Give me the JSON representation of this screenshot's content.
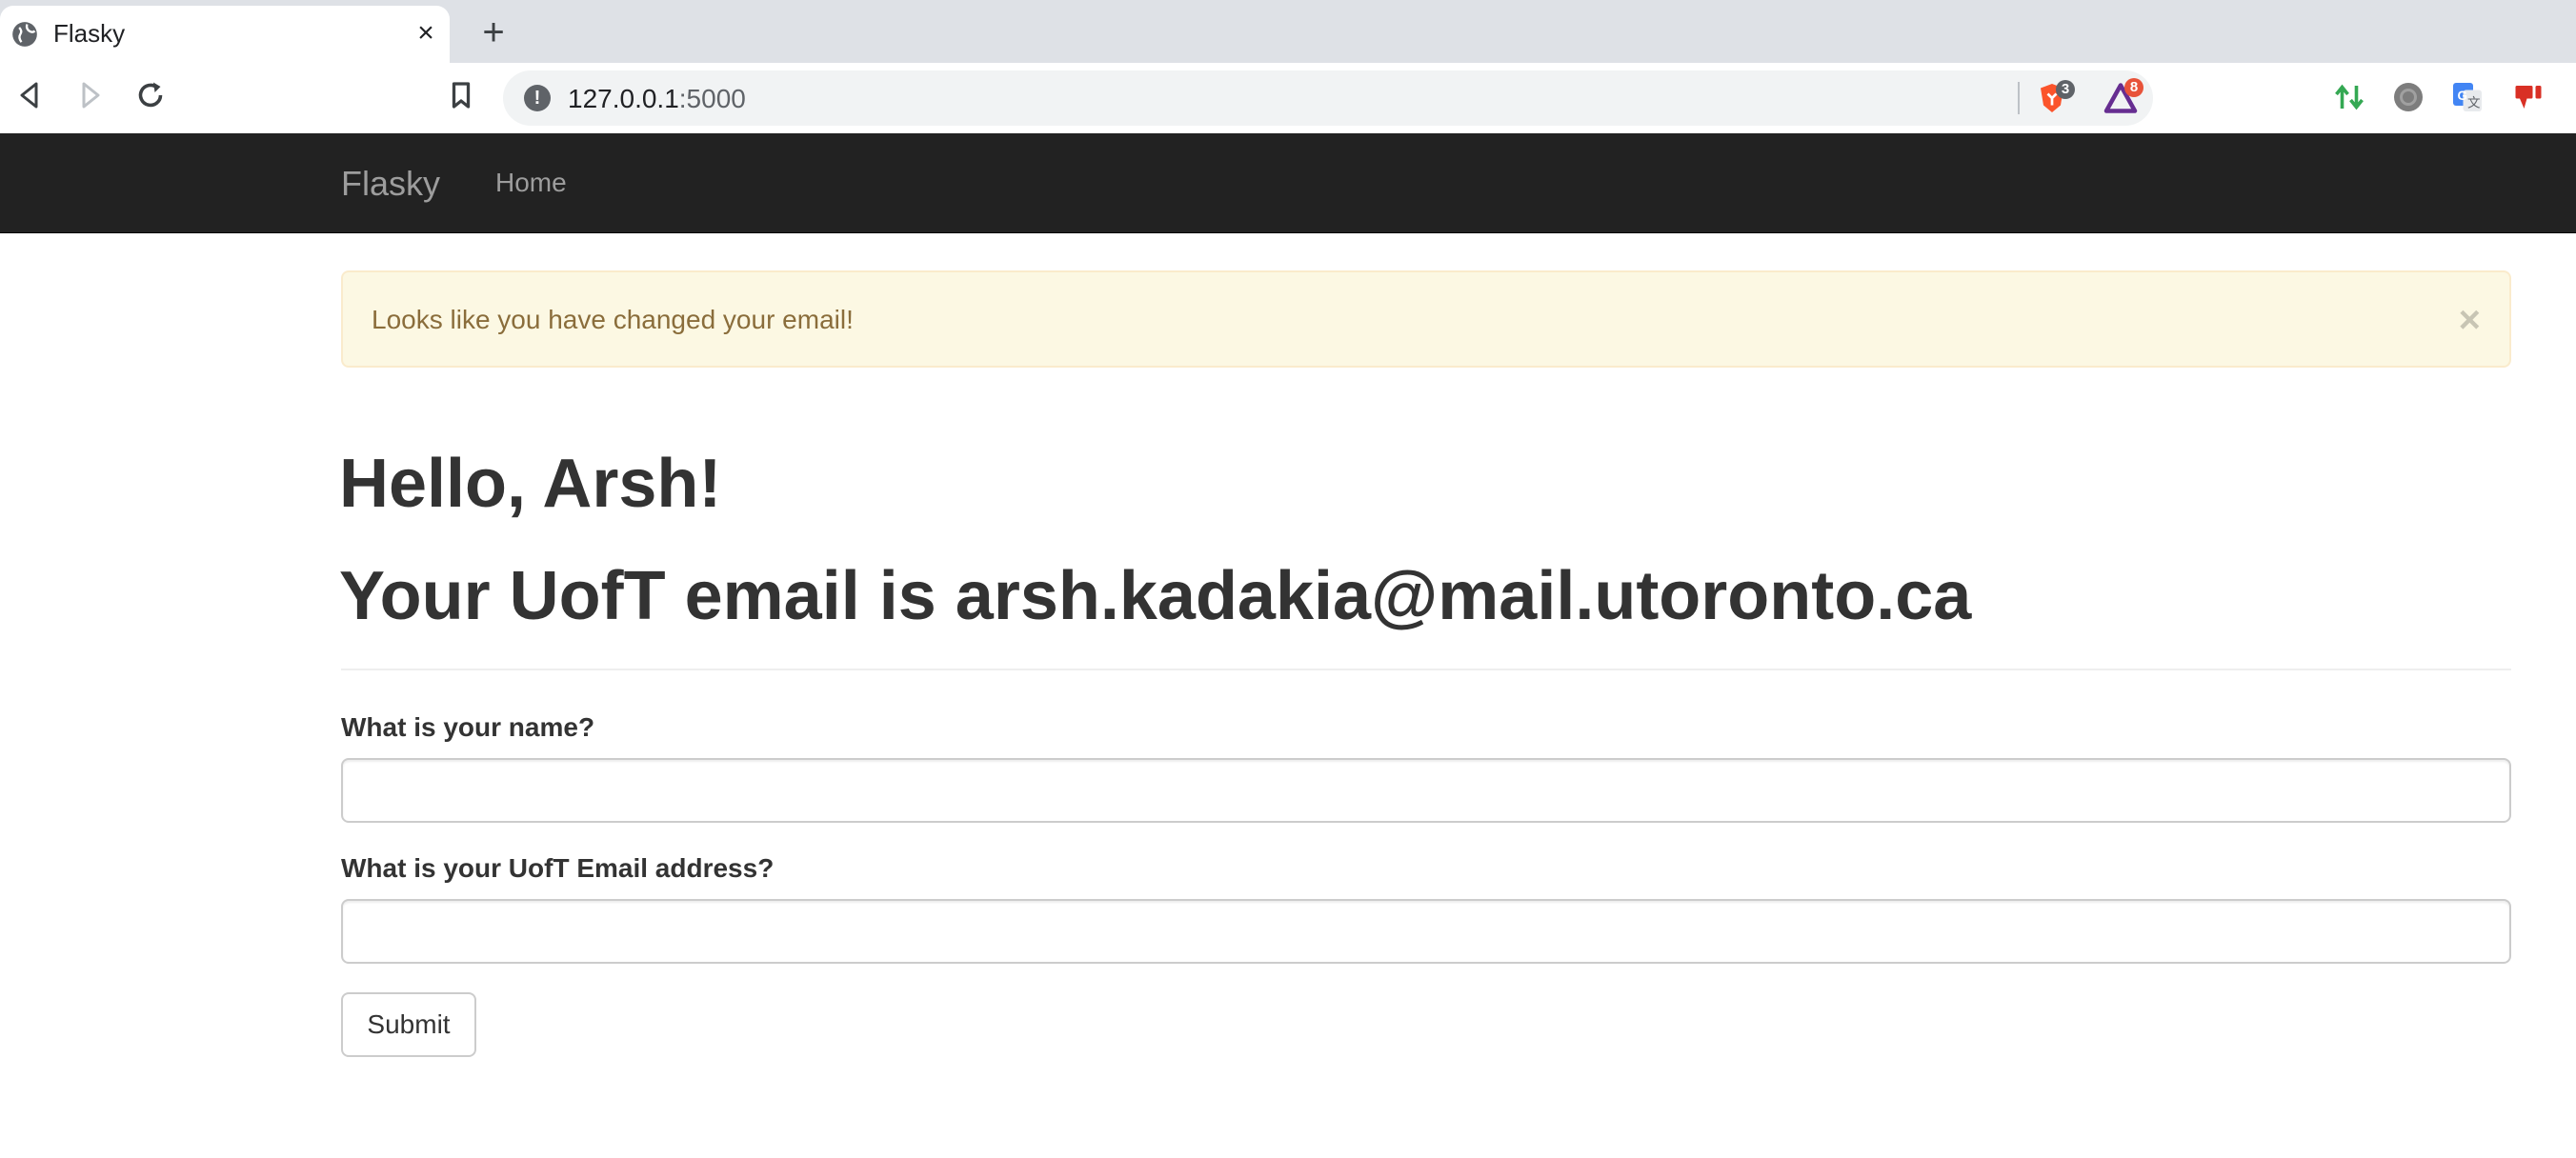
{
  "browser": {
    "tab_title": "Flasky",
    "url_host": "127.0.0.1",
    "url_port": ":5000",
    "extensions": [
      {
        "name": "brave-shields-icon",
        "badge": "3",
        "badge_color": "#5f6368"
      },
      {
        "name": "brave-rewards-icon",
        "badge": "8",
        "badge_color": "#e8533a"
      }
    ]
  },
  "navbar": {
    "brand": "Flasky",
    "home_link": "Home"
  },
  "alert": {
    "message": "Looks like you have changed your email!",
    "close": "×"
  },
  "main": {
    "greeting": "Hello, Arsh!",
    "email_line": "Your UofT email is arsh.kadakia@mail.utoronto.ca"
  },
  "form": {
    "name_label": "What is your name?",
    "name_value": "",
    "email_label": "What is your UofT Email address?",
    "email_value": "",
    "submit_label": "Submit"
  },
  "colors": {
    "navbar_bg": "#222222",
    "alert_bg": "#fcf8e3",
    "alert_text": "#8a6d3b",
    "heading_text": "#333333"
  }
}
